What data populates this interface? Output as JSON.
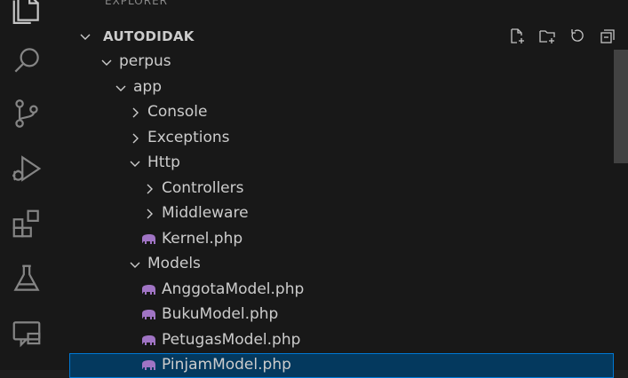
{
  "explorer": {
    "header": "EXPLORER",
    "section_title": "AUTODIDAK",
    "actions": [
      {
        "name": "new-file-icon"
      },
      {
        "name": "new-folder-icon"
      },
      {
        "name": "refresh-icon"
      },
      {
        "name": "collapse-all-icon"
      }
    ],
    "tree": [
      {
        "label": "perpus",
        "type": "folder",
        "expanded": true,
        "depth": 0
      },
      {
        "label": "app",
        "type": "folder",
        "expanded": true,
        "depth": 1
      },
      {
        "label": "Console",
        "type": "folder",
        "expanded": false,
        "depth": 2
      },
      {
        "label": "Exceptions",
        "type": "folder",
        "expanded": false,
        "depth": 2
      },
      {
        "label": "Http",
        "type": "folder",
        "expanded": true,
        "depth": 2
      },
      {
        "label": "Controllers",
        "type": "folder",
        "expanded": false,
        "depth": 3
      },
      {
        "label": "Middleware",
        "type": "folder",
        "expanded": false,
        "depth": 3
      },
      {
        "label": "Kernel.php",
        "type": "file",
        "depth": 3
      },
      {
        "label": "Models",
        "type": "folder",
        "expanded": true,
        "depth": 2
      },
      {
        "label": "AnggotaModel.php",
        "type": "file",
        "depth": 3
      },
      {
        "label": "BukuModel.php",
        "type": "file",
        "depth": 3
      },
      {
        "label": "PetugasModel.php",
        "type": "file",
        "depth": 3
      },
      {
        "label": "PinjamModel.php",
        "type": "file",
        "depth": 3,
        "selected": true
      }
    ]
  },
  "activity_bar": [
    {
      "name": "explorer-files-icon"
    },
    {
      "name": "search-icon"
    },
    {
      "name": "source-control-icon"
    },
    {
      "name": "run-debug-icon"
    },
    {
      "name": "extensions-icon"
    },
    {
      "name": "testing-flask-icon"
    },
    {
      "name": "remote-explorer-icon"
    }
  ],
  "colors": {
    "background": "#181818",
    "text": "#cccccc",
    "selection": "#04395e",
    "selection_border": "#0078d4",
    "php_icon": "#a074c4"
  }
}
